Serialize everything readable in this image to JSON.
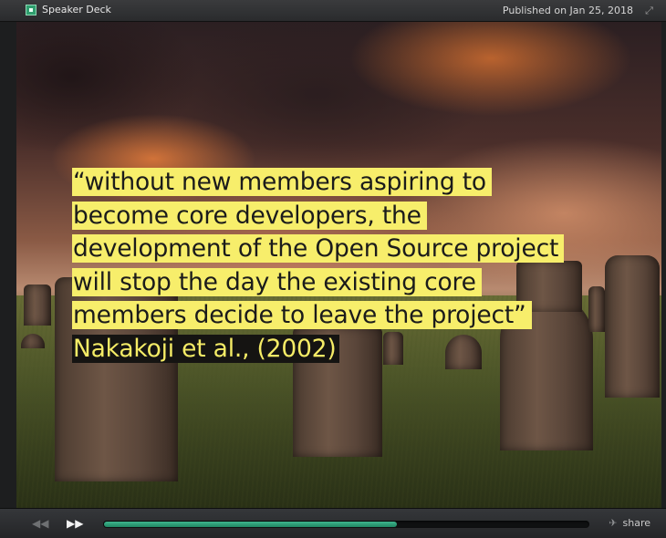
{
  "topbar": {
    "brand": "Speaker Deck",
    "published": "Published on Jan 25, 2018",
    "fullscreen_icon": "expand-icon"
  },
  "slide": {
    "quote_lines": [
      "“without new members aspiring to",
      "become core developers, the",
      "development of the Open Source project",
      "will stop the day the existing core",
      "members decide to leave the project”"
    ],
    "attribution": "Nakakoji et al., (2002)",
    "highlight_color": "#f7ee6b",
    "attribution_bg": "#151412",
    "attribution_color": "#f5ec66"
  },
  "controls": {
    "prev_icon": "rewind-icon",
    "next_icon": "fast-forward-icon",
    "progress": 0.605,
    "share_label": "share",
    "share_icon": "twitter-bird-icon",
    "accent_color": "#2e9e76"
  }
}
